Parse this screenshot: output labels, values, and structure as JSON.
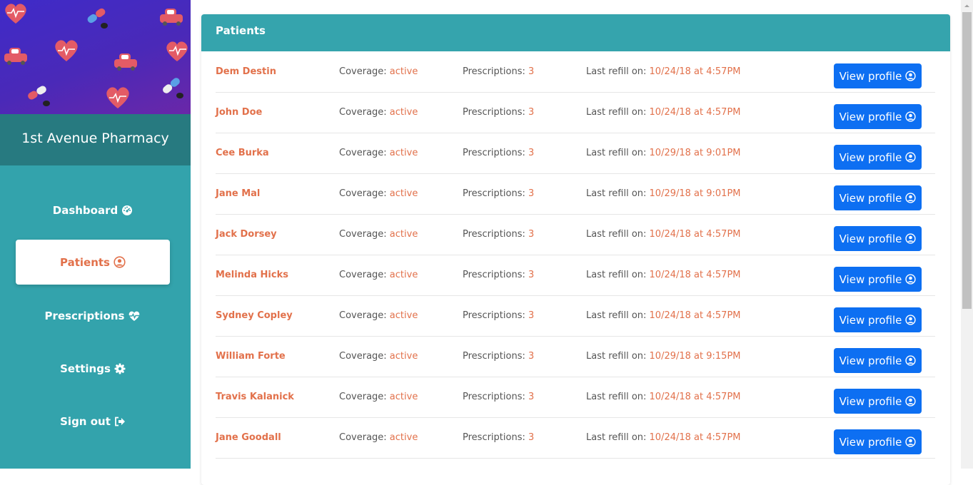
{
  "app": {
    "pharmacy_name": "1st Avenue Pharmacy"
  },
  "sidebar": {
    "items": [
      {
        "label": "Dashboard",
        "icon": "dashboard-gauge-icon"
      },
      {
        "label": "Patients",
        "icon": "user-circle-icon",
        "active": true
      },
      {
        "label": "Prescriptions",
        "icon": "heartbeat-icon"
      },
      {
        "label": "Settings",
        "icon": "gear-icon"
      },
      {
        "label": "Sign out",
        "icon": "sign-out-icon"
      }
    ]
  },
  "main": {
    "title": "Patients",
    "labels": {
      "coverage": "Coverage: ",
      "prescriptions": "Prescriptions: ",
      "last_refill": "Last refill on: ",
      "view_profile": "View profile"
    },
    "patients": [
      {
        "name": "Dem Destin",
        "coverage": "active",
        "prescriptions": "3",
        "last_refill": "10/24/18 at 4:57PM"
      },
      {
        "name": "John Doe",
        "coverage": "active",
        "prescriptions": "3",
        "last_refill": "10/24/18 at 4:57PM"
      },
      {
        "name": "Cee Burka",
        "coverage": "active",
        "prescriptions": "3",
        "last_refill": "10/29/18 at 9:01PM"
      },
      {
        "name": "Jane Mal",
        "coverage": "active",
        "prescriptions": "3",
        "last_refill": "10/29/18 at 9:01PM"
      },
      {
        "name": "Jack Dorsey",
        "coverage": "active",
        "prescriptions": "3",
        "last_refill": "10/24/18 at 4:57PM"
      },
      {
        "name": "Melinda Hicks",
        "coverage": "active",
        "prescriptions": "3",
        "last_refill": "10/24/18 at 4:57PM"
      },
      {
        "name": "Sydney Copley",
        "coverage": "active",
        "prescriptions": "3",
        "last_refill": "10/24/18 at 4:57PM"
      },
      {
        "name": "William Forte",
        "coverage": "active",
        "prescriptions": "3",
        "last_refill": "10/29/18 at 9:15PM"
      },
      {
        "name": "Travis Kalanick",
        "coverage": "active",
        "prescriptions": "3",
        "last_refill": "10/24/18 at 4:57PM"
      },
      {
        "name": "Jane Goodall",
        "coverage": "active",
        "prescriptions": "3",
        "last_refill": "10/24/18 at 4:57PM"
      }
    ]
  },
  "colors": {
    "sidebar": "#33a3ac",
    "brand_bar": "#277a80",
    "accent_orange": "#e2714b",
    "button_blue": "#0d6ff2"
  }
}
